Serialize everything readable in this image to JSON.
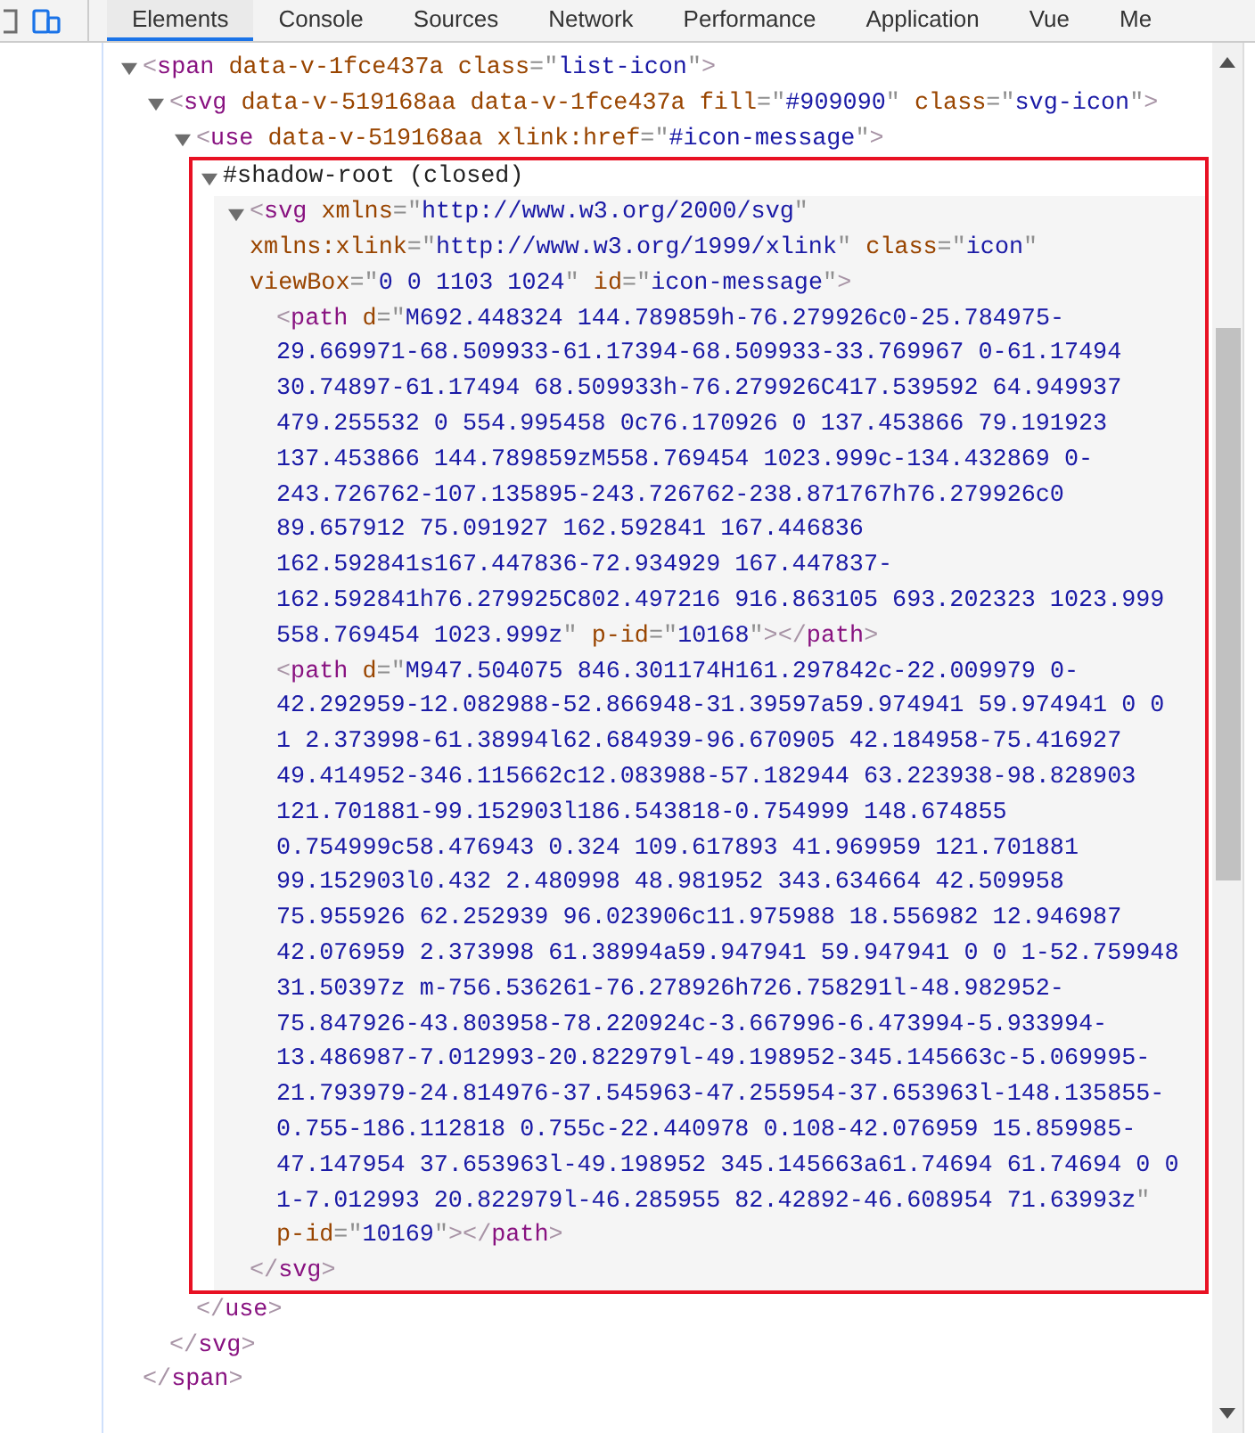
{
  "tabs": [
    {
      "label": "Elements",
      "selected": true
    },
    {
      "label": "Console",
      "selected": false
    },
    {
      "label": "Sources",
      "selected": false
    },
    {
      "label": "Network",
      "selected": false
    },
    {
      "label": "Performance",
      "selected": false
    },
    {
      "label": "Application",
      "selected": false
    },
    {
      "label": "Vue",
      "selected": false
    },
    {
      "label": "Me",
      "selected": false
    }
  ],
  "tree": [
    {
      "kind": "element",
      "open_tag": "<span data-v-1fce437a class=\"list-icon\">",
      "expanded": true,
      "closing_tag": "</span>",
      "children": [
        {
          "kind": "element",
          "open_tag": "<svg data-v-519168aa data-v-1fce437a fill=\"#909090\" class=\"svg-icon\">",
          "expanded": true,
          "closing_tag": "</svg>",
          "children": [
            {
              "kind": "element",
              "open_tag": "<use data-v-519168aa xlink:href=\"#icon-message\">",
              "expanded": true,
              "closing_tag": "</use>",
              "children": [
                {
                  "kind": "shadow-root",
                  "label": "#shadow-root (closed)",
                  "expanded": true,
                  "annotated": true,
                  "children": [
                    {
                      "kind": "element",
                      "open_tag": "<svg xmlns=\"http://www.w3.org/2000/svg\" xmlns:xlink=\"http://www.w3.org/1999/xlink\" class=\"icon\" viewBox=\"0 0 1103 1024\" id=\"icon-message\">",
                      "expanded": true,
                      "hovered": true,
                      "closing_tag": "</svg>",
                      "children": [
                        {
                          "kind": "leaf",
                          "open_tag": "<path d=\"M692.448324 144.789859h-76.279926c0-25.784975-29.669971-68.509933-61.17394-68.509933-33.769967 0-61.17494 30.74897-61.17494 68.509933h-76.279926C417.539592 64.949937 479.255532 0 554.995458 0c76.170926 0 137.453866 79.191923 137.453866 144.789859zM558.769454 1023.999c-134.432869 0-243.726762-107.135895-243.726762-238.871767h76.279926c0 89.657912 75.091927 162.592841 167.446836 162.592841s167.447836-72.934929 167.447837-162.592841h76.279925C802.497216 916.863105 693.202323 1023.999 558.769454 1023.999z\" p-id=\"10168\"></path>"
                        },
                        {
                          "kind": "leaf",
                          "open_tag": "<path d=\"M947.504075 846.301174H161.297842c-22.009979 0-42.292959-12.082988-52.866948-31.39597a59.974941 59.974941 0 0 1 2.373998-61.38994l62.684939-96.670905 42.184958-75.416927 49.414952-346.115662c12.083988-57.182944 63.223938-98.828903 121.701881-99.152903l186.543818-0.754999 148.674855 0.754999c58.476943 0.324 109.617893 41.969959 121.701881 99.152903l0.432 2.480998 48.981952 343.634664 42.509958 75.955926 62.252939 96.023906c11.975988 18.556982 12.946987 42.076959 2.373998 61.38994a59.947941 59.947941 0 0 1-52.759948 31.50397z m-756.536261-76.278926h726.758291l-48.982952-75.847926-43.803958-78.220924c-3.667996-6.473994-5.933994-13.486987-7.012993-20.822979l-49.198952-345.145663c-5.069995-21.793979-24.814976-37.545963-47.255954-37.653963l-148.135855-0.755-186.112818 0.755c-22.440978 0.108-42.076959 15.859985-47.147954 37.653963l-49.198952 345.145663a61.74694 61.74694 0 0 1-7.012993 20.822979l-46.285955 82.42892-46.608954 71.63993z\" p-id=\"10169\"></path>"
                        }
                      ]
                    }
                  ]
                }
              ]
            }
          ]
        }
      ]
    }
  ]
}
